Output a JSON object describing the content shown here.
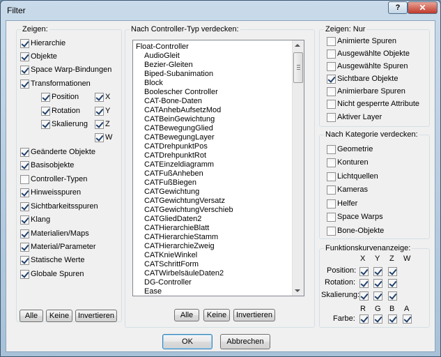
{
  "window": {
    "title": "Filter",
    "help_label": "?",
    "close_label": "✕"
  },
  "show": {
    "title": "Zeigen:",
    "items": [
      {
        "label": "Hierarchie",
        "checked": true
      },
      {
        "label": "Objekte",
        "checked": true
      },
      {
        "label": "Space Warp-Bindungen",
        "checked": true
      },
      {
        "label": "Transformationen",
        "checked": true
      },
      {
        "label": "Position",
        "checked": true
      },
      {
        "label": "Rotation",
        "checked": true
      },
      {
        "label": "Skalierung",
        "checked": true
      },
      {
        "label": "Geänderte Objekte",
        "checked": true
      },
      {
        "label": "Basisobjekte",
        "checked": true
      },
      {
        "label": "Controller-Typen",
        "checked": false
      },
      {
        "label": "Hinweisspuren",
        "checked": true
      },
      {
        "label": "Sichtbarkeitsspuren",
        "checked": true
      },
      {
        "label": "Klang",
        "checked": true
      },
      {
        "label": "Materialien/Maps",
        "checked": true
      },
      {
        "label": "Material/Parameter",
        "checked": true
      },
      {
        "label": "Statische Werte",
        "checked": true
      },
      {
        "label": "Globale Spuren",
        "checked": true
      }
    ],
    "axes": [
      {
        "label": "X",
        "checked": true
      },
      {
        "label": "Y",
        "checked": true
      },
      {
        "label": "Z",
        "checked": true
      },
      {
        "label": "W",
        "checked": true
      }
    ],
    "buttons": {
      "all": "Alle",
      "none": "Keine",
      "invert": "Invertieren"
    }
  },
  "controller": {
    "title": "Nach Controller-Typ verdecken:",
    "items": [
      "Float-Controller",
      "AudioGleit",
      "Bezier-Gleiten",
      "Biped-Subanimation",
      "Block",
      "Boolescher Controller",
      "CAT-Bone-Daten",
      "CATAnhebAufsetzMod",
      "CATBeinGewichtung",
      "CATBewegungGlied",
      "CATBewegungLayer",
      "CATDrehpunktPos",
      "CATDrehpunktRot",
      "CATEinzeldiagramm",
      "CATFußAnheben",
      "CATFußBiegen",
      "CATGewichtung",
      "CATGewichtungVersatz",
      "CATGewichtungVerschieb",
      "CATGliedDaten2",
      "CATHierarchieBlatt",
      "CATHierarchieStamm",
      "CATHierarchieZweig",
      "CATKnieWinkel",
      "CATSchrittForm",
      "CATWirbelsäuleDaten2",
      "DG-Controller",
      "Ease"
    ],
    "buttons": {
      "all": "Alle",
      "none": "Keine",
      "invert": "Invertieren"
    }
  },
  "only": {
    "title": "Zeigen: Nur",
    "items": [
      {
        "label": "Animierte Spuren",
        "checked": false
      },
      {
        "label": "Ausgewählte Objekte",
        "checked": false
      },
      {
        "label": "Ausgewählte Spuren",
        "checked": false
      },
      {
        "label": "Sichtbare Objekte",
        "checked": true
      },
      {
        "label": "Animierbare Spuren",
        "checked": false
      },
      {
        "label": "Nicht gesperrte Attribute",
        "checked": false
      },
      {
        "label": "Aktiver Layer",
        "checked": false
      }
    ]
  },
  "category": {
    "title": "Nach Kategorie verdecken:",
    "items": [
      {
        "label": "Geometrie",
        "checked": false
      },
      {
        "label": "Konturen",
        "checked": false
      },
      {
        "label": "Lichtquellen",
        "checked": false
      },
      {
        "label": "Kameras",
        "checked": false
      },
      {
        "label": "Helfer",
        "checked": false
      },
      {
        "label": "Space Warps",
        "checked": false
      },
      {
        "label": "Bone-Objekte",
        "checked": false
      }
    ]
  },
  "curves": {
    "title": "Funktionskurvenanzeige:",
    "axis_headers": [
      "X",
      "Y",
      "Z",
      "W"
    ],
    "rows": [
      {
        "label": "Position:",
        "checks": [
          true,
          true,
          true
        ]
      },
      {
        "label": "Rotation:",
        "checks": [
          true,
          true,
          true
        ]
      },
      {
        "label": "Skalierung:",
        "checks": [
          true,
          true,
          true
        ]
      }
    ],
    "color_headers": [
      "R",
      "G",
      "B",
      "A"
    ],
    "color_label": "Farbe:",
    "color_checks": [
      true,
      true,
      true,
      true
    ]
  },
  "footer": {
    "ok": "OK",
    "cancel": "Abbrechen"
  }
}
